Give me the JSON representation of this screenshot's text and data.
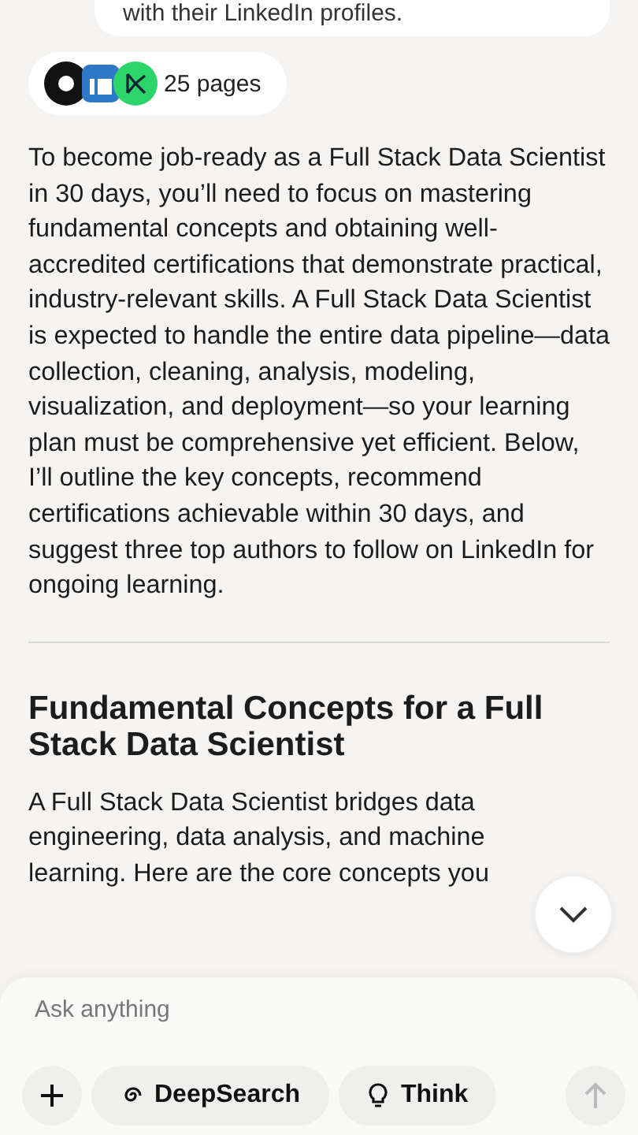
{
  "previous_message": {
    "text": "with their LinkedIn profiles."
  },
  "sources": {
    "label": "25 pages"
  },
  "intro": "To become job-ready as a Full Stack Data Scientist in 30 days, you’ll need to focus on mastering fundamental concepts and obtaining well-accredited certifications that demonstrate practical, industry-relevant skills. A Full Stack Data Scientist is expected to handle the entire data pipeline—data collection, cleaning, analysis, modeling, visualization, and deployment—so your learning plan must be comprehensive yet efficient. Below, I’ll outline the key concepts, recommend certifications achievable within 30 days, and suggest three top authors to follow on LinkedIn for ongoing learning.",
  "section": {
    "heading": "Fundamental Concepts for a Full Stack Data Scientist",
    "text": "A Full Stack Data Scientist bridges data engineering, data analysis, and machine learning. Here are the core concepts you"
  },
  "composer": {
    "placeholder": "Ask anything",
    "buttons": [
      {
        "kind": "plus"
      },
      {
        "kind": "deepsearch",
        "label": "DeepSearch",
        "selected": false
      },
      {
        "kind": "think",
        "label": "Think",
        "selected": false
      },
      {
        "kind": "send"
      }
    ]
  }
}
